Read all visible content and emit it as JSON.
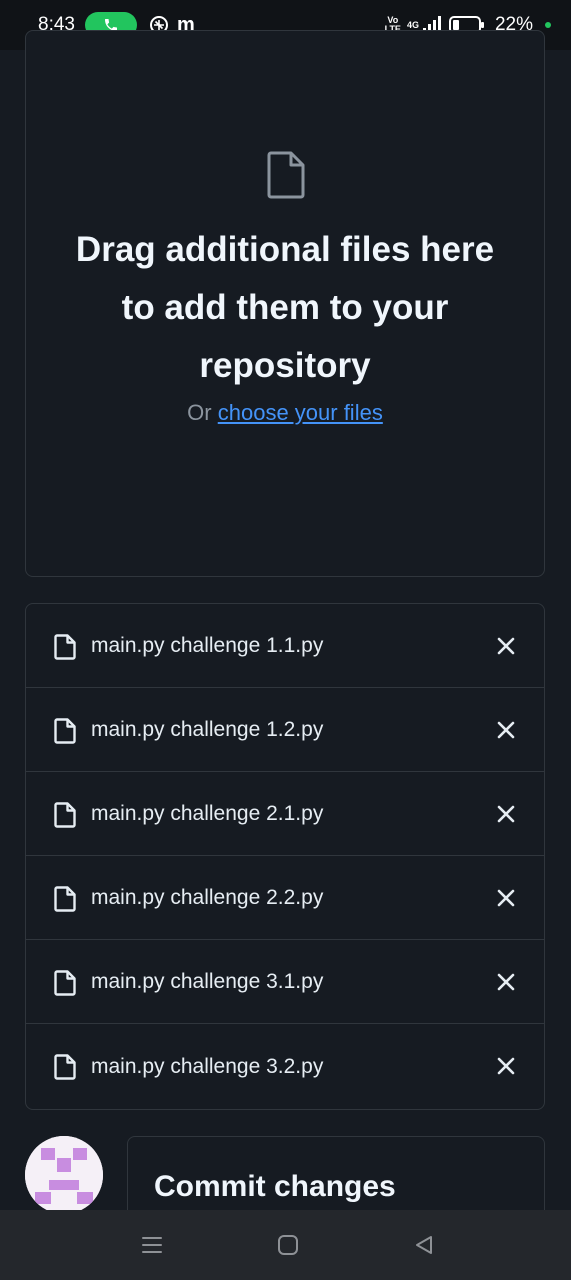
{
  "status_bar": {
    "time": "8:43",
    "network": "4G",
    "volte_top": "Vo",
    "volte_bottom": "LTE",
    "battery_percent": "22%",
    "icons": [
      "phone-call-icon",
      "vpn-icon",
      "m-app-icon",
      "signal-icon",
      "battery-icon",
      "charging-dot-icon"
    ],
    "m_label": "m"
  },
  "dropzone": {
    "title": "Drag additional files here to add them to your repository",
    "prefix": "Or",
    "link": "choose your files"
  },
  "files": [
    {
      "name": "main.py challenge 1.1.py"
    },
    {
      "name": "main.py challenge 1.2.py"
    },
    {
      "name": "main.py challenge 2.1.py"
    },
    {
      "name": "main.py challenge 2.2.py"
    },
    {
      "name": "main.py challenge 3.1.py"
    },
    {
      "name": "main.py challenge 3.2.py"
    }
  ],
  "commit": {
    "title": "Commit changes"
  },
  "colors": {
    "background": "#161b22",
    "border": "#30363d",
    "link": "#4493f8",
    "call_green": "#22c55e",
    "avatar_purple": "#c88de0"
  }
}
